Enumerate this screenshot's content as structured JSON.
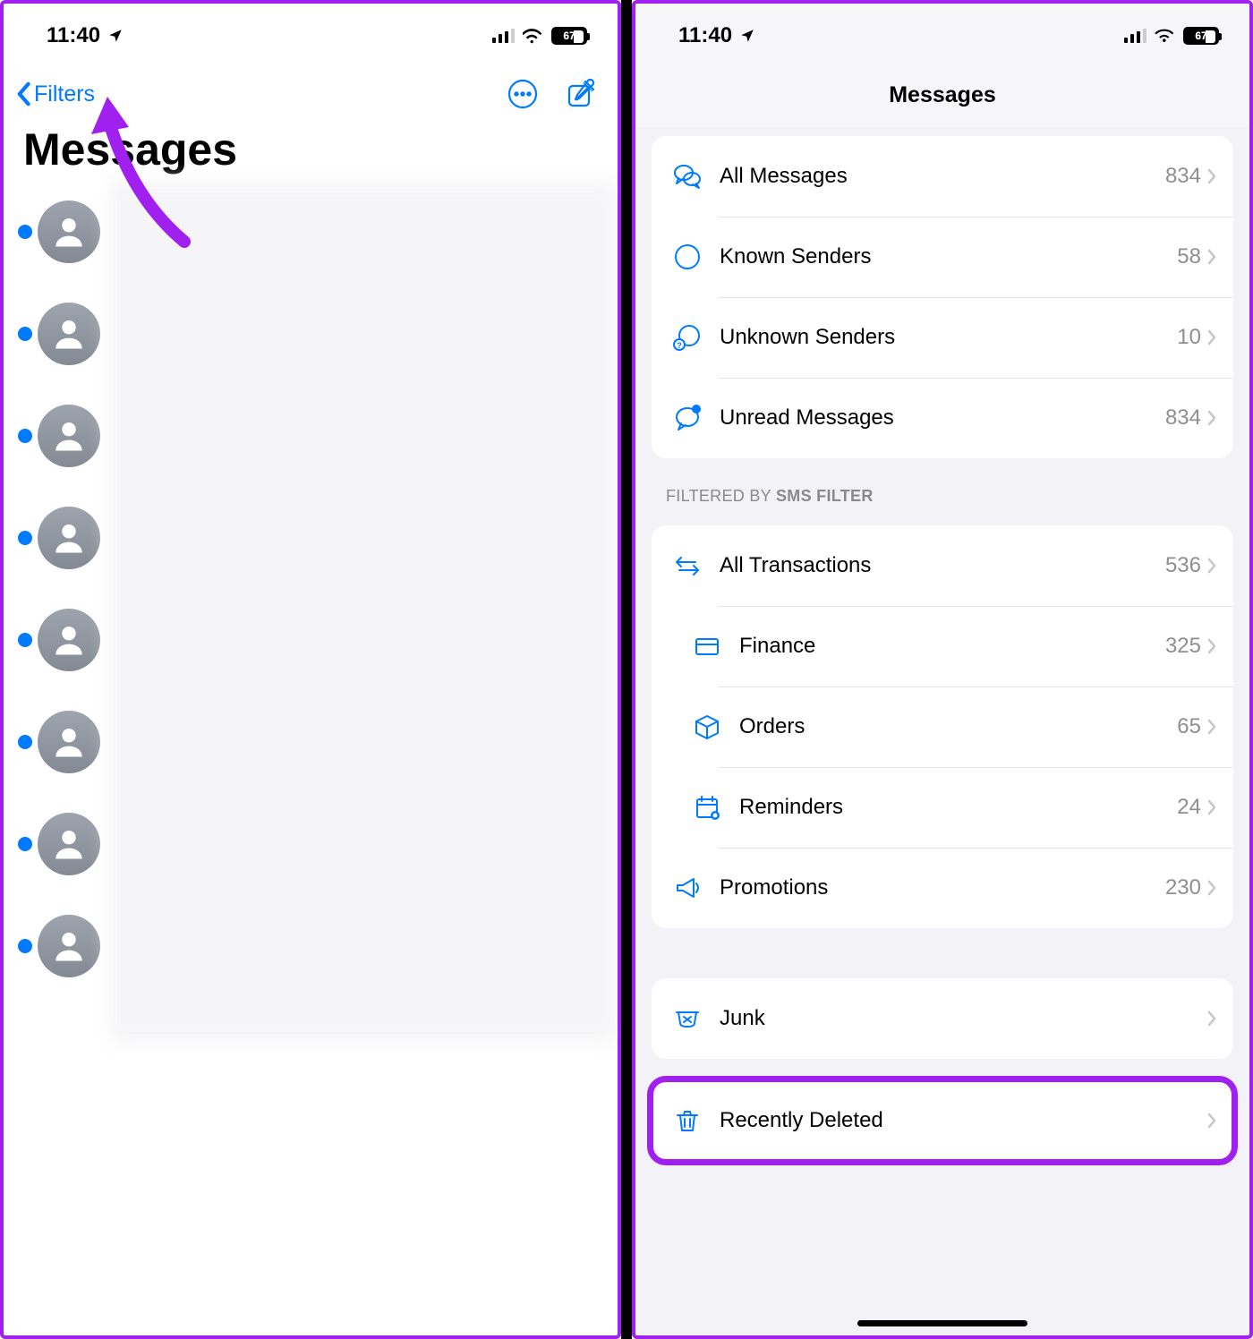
{
  "status": {
    "time": "11:40",
    "battery": "67"
  },
  "left": {
    "back_label": "Filters",
    "title": "Messages",
    "conversation_count": 8
  },
  "right": {
    "header": "Messages",
    "section1": [
      {
        "icon": "bubbles",
        "label": "All Messages",
        "count": "834"
      },
      {
        "icon": "person-circle",
        "label": "Known Senders",
        "count": "58"
      },
      {
        "icon": "person-question",
        "label": "Unknown Senders",
        "count": "10"
      },
      {
        "icon": "bubble-dot",
        "label": "Unread Messages",
        "count": "834"
      }
    ],
    "section2_header_prefix": "FILTERED BY ",
    "section2_header_bold": "SMS FILTER",
    "section2": [
      {
        "icon": "arrows",
        "label": "All Transactions",
        "count": "536",
        "sub": false
      },
      {
        "icon": "card",
        "label": "Finance",
        "count": "325",
        "sub": true
      },
      {
        "icon": "box",
        "label": "Orders",
        "count": "65",
        "sub": true
      },
      {
        "icon": "calendar",
        "label": "Reminders",
        "count": "24",
        "sub": true
      },
      {
        "icon": "megaphone",
        "label": "Promotions",
        "count": "230",
        "sub": false
      }
    ],
    "section3": [
      {
        "icon": "junk",
        "label": "Junk",
        "count": ""
      }
    ],
    "section4": [
      {
        "icon": "trash",
        "label": "Recently Deleted",
        "count": ""
      }
    ]
  }
}
